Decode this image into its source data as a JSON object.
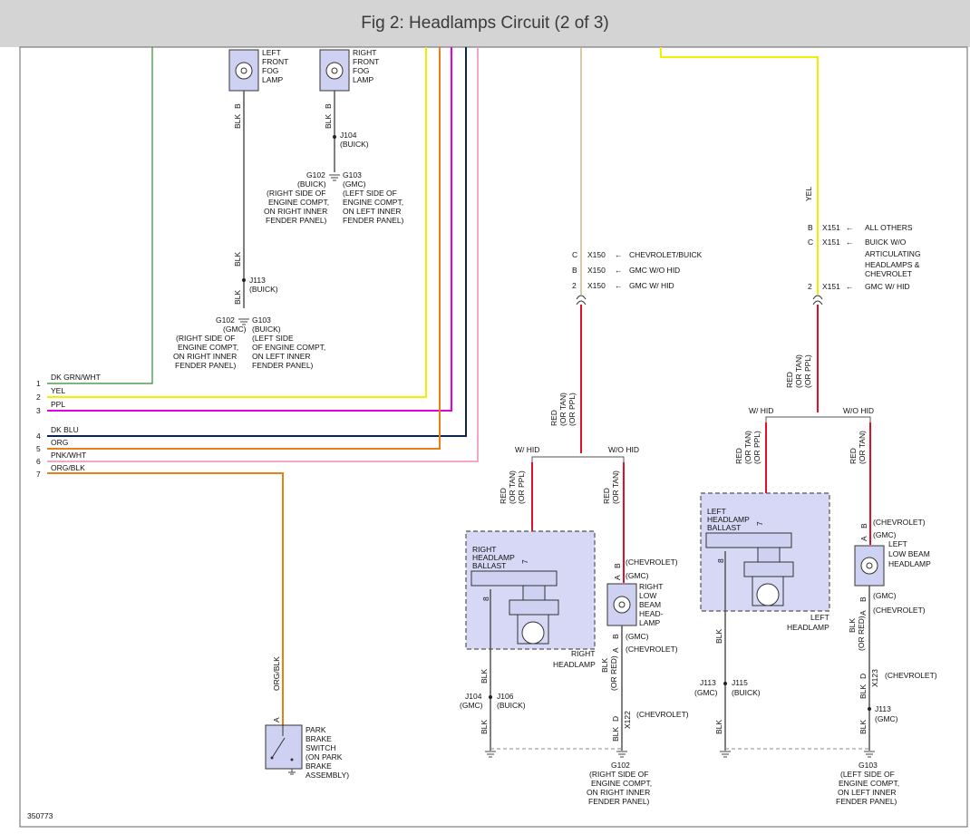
{
  "title": "Fig 2: Headlamps Circuit (2 of 3)",
  "figure_number": "350773",
  "colors": {
    "wire_green": "#2e8b2e",
    "wire_yellow": "#f2ef00",
    "wire_purple": "#e000e0",
    "wire_blue": "#0d2350",
    "wire_orange": "#e8801a",
    "wire_pink": "#f4a6c4",
    "wire_red": "#e0102a",
    "wire_tan": "#c8b88a",
    "wire_black": "#555555"
  },
  "wire_rows": [
    {
      "n": "1",
      "label": "DK GRN/WHT"
    },
    {
      "n": "2",
      "label": "YEL"
    },
    {
      "n": "3",
      "label": "PPL"
    },
    {
      "n": "4",
      "label": "DK BLU"
    },
    {
      "n": "5",
      "label": "ORG"
    },
    {
      "n": "6",
      "label": "PNK/WHT"
    },
    {
      "n": "7",
      "label": "ORG/BLK"
    }
  ],
  "fog_lamps": {
    "left": {
      "line1": "LEFT",
      "line2": "FRONT",
      "line3": "FOG",
      "line4": "LAMP"
    },
    "right": {
      "line1": "RIGHT",
      "line2": "FRONT",
      "line3": "FOG",
      "line4": "LAMP"
    }
  },
  "fog_wiring": {
    "pin_b": "B",
    "blk": "BLK",
    "j104": "J104",
    "buick": "(BUICK)",
    "gmc": "(GMC)",
    "g102": "G102",
    "g103": "G103",
    "j113": "J113",
    "rs1": "(RIGHT SIDE OF",
    "rs2": "ENGINE COMPT,",
    "rs3": "ON RIGHT INNER",
    "rs4": "FENDER PANEL)",
    "ls1": "(LEFT SIDE OF",
    "ls2": "ENGINE COMPT,",
    "ls3": "ON LEFT INNER",
    "ls4": "FENDER PANEL)",
    "ls1b": "(LEFT SIDE",
    "ls2b": "OF ENGINE COMPT,"
  },
  "connectors": {
    "x150": [
      {
        "pin": "C",
        "id": "X150",
        "desc": "CHEVROLET/BUICK"
      },
      {
        "pin": "B",
        "id": "X150",
        "desc": "GMC W/O HID"
      },
      {
        "pin": "2",
        "id": "X150",
        "desc": "GMC W/ HID"
      }
    ],
    "x151": [
      {
        "pin": "B",
        "id": "X151",
        "desc": "ALL OTHERS"
      },
      {
        "pin": "C",
        "id": "X151",
        "desc1": "BUICK W/O",
        "desc2": "ARTICULATING",
        "desc3": "HEADLAMPS &",
        "desc4": "CHEVROLET"
      },
      {
        "pin": "2",
        "id": "X151",
        "desc": "GMC W/ HID"
      }
    ]
  },
  "labels": {
    "yel": "YEL",
    "red": "RED",
    "or_tan": "(OR TAN)",
    "or_ppl": "(OR PPL)",
    "or_red": "(OR RED)",
    "w_hid": "W/ HID",
    "wo_hid": "W/O HID",
    "blk": "BLK",
    "chevrolet": "(CHEVROLET)",
    "gmc": "(GMC)",
    "buick": "(BUICK)",
    "pin_a": "A",
    "pin_b": "B",
    "pin_d": "D",
    "pin_7": "7",
    "pin_8": "8",
    "x122": "X122",
    "x123": "X123",
    "j104": "J104",
    "j106": "J106",
    "j113": "J113",
    "j115": "J115",
    "g102": "G102",
    "g103": "G103"
  },
  "components": {
    "right_ballast": {
      "l1": "RIGHT",
      "l2": "HEADLAMP",
      "l3": "BALLAST"
    },
    "right_headlamp": {
      "l1": "RIGHT",
      "l2": "HEADLAMP"
    },
    "right_low_beam": {
      "l1": "RIGHT",
      "l2": "LOW",
      "l3": "BEAM",
      "l4": "HEAD-",
      "l5": "LAMP"
    },
    "left_ballast": {
      "l1": "LEFT",
      "l2": "HEADLAMP",
      "l3": "BALLAST"
    },
    "left_headlamp": {
      "l1": "LEFT",
      "l2": "HEADLAMP"
    },
    "left_low_beam": {
      "l1": "LEFT",
      "l2": "LOW BEAM",
      "l3": "HEADLAMP"
    },
    "park_brake": {
      "l1": "PARK",
      "l2": "BRAKE",
      "l3": "SWITCH",
      "l4": "(ON PARK",
      "l5": "BRAKE",
      "l6": "ASSEMBLY)"
    },
    "org_blk": "ORG/BLK"
  },
  "grounds": {
    "g102": {
      "name": "G102",
      "l1": "(RIGHT SIDE OF",
      "l2": "ENGINE COMPT,",
      "l3": "ON RIGHT INNER",
      "l4": "FENDER PANEL)"
    },
    "g103": {
      "name": "G103",
      "l1": "(LEFT SIDE OF",
      "l2": "ENGINE COMPT,",
      "l3": "ON LEFT INNER",
      "l4": "FENDER PANEL)"
    }
  }
}
